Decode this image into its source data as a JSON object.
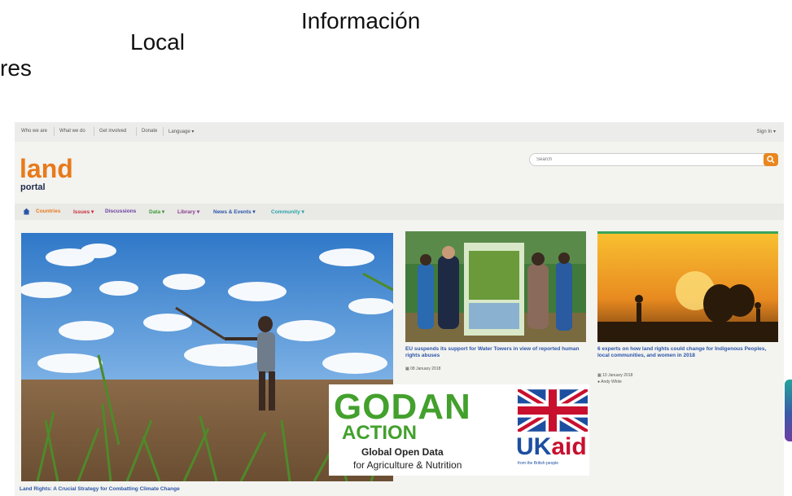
{
  "floating_words": [
    "Información",
    "Local",
    "res"
  ],
  "topbar": {
    "links": [
      "Who we are",
      "What we do",
      "Get involved",
      "Donate",
      "Language ▾"
    ],
    "signin": "Sign In ▾"
  },
  "logo": {
    "word": "land",
    "sub": "portal"
  },
  "search": {
    "placeholder": "Search"
  },
  "nav": {
    "items": [
      {
        "label": "Countries",
        "color": "#e87a1a"
      },
      {
        "label": "Issues ▾",
        "color": "#c8303a"
      },
      {
        "label": "Discussions",
        "color": "#6b3fa0"
      },
      {
        "label": "Data ▾",
        "color": "#3c9a34"
      },
      {
        "label": "Library ▾",
        "color": "#8a3c8f"
      },
      {
        "label": "News & Events ▾",
        "color": "#2b55a8"
      },
      {
        "label": "Community ▾",
        "color": "#2aa3a8"
      }
    ]
  },
  "hero": {
    "caption": "Land Rights: A Crucial Strategy for Combatting Climate Change"
  },
  "cards": [
    {
      "title": "EU suspends its support for Water Towers in view of reported human rights abuses",
      "date": "08 January 2018"
    },
    {
      "title": "6 experts on how land rights could change for Indigenous Peoples, local communities, and women in 2018",
      "date": "10 January 2018",
      "author": "Andy White"
    }
  ],
  "sponsors": {
    "godan": "GODAN",
    "action": "ACTION",
    "line1": "Global Open Data",
    "line2": "for Agriculture & Nutrition",
    "uk": "UK",
    "aid": "aid",
    "ukaid_tag": "from the British people"
  }
}
